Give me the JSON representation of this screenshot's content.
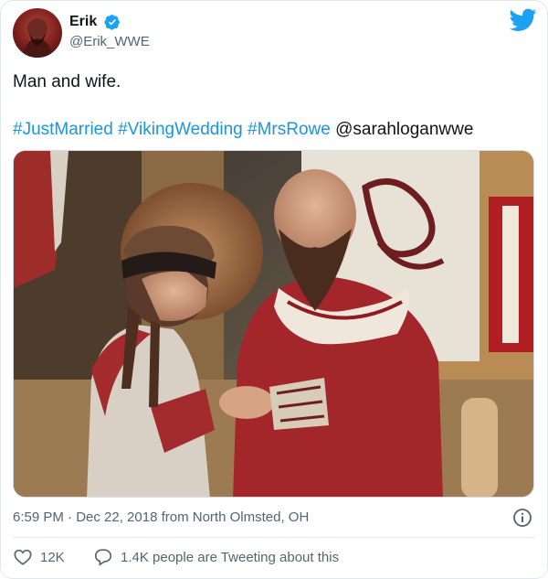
{
  "tweet": {
    "display_name": "Erik",
    "handle": "@Erik_WWE",
    "text": "Man and wife.",
    "hashtags": [
      "#JustMarried",
      "#VikingWedding",
      "#MrsRowe"
    ],
    "mention": "@sarahloganwwe",
    "timestamp": "6:59 PM · Dec 22, 2018 from North Olmsted, OH",
    "likes": "12K",
    "discussion": "1.4K people are Tweeting about this"
  },
  "icons": {
    "verified": "verified-badge-icon",
    "logo": "twitter-bird-icon",
    "info": "info-icon",
    "like": "heart-icon",
    "reply": "comment-bubble-icon"
  },
  "colors": {
    "link": "#1b95e0",
    "text": "#0f1419",
    "secondary": "#536471",
    "brand": "#1da1f2"
  }
}
